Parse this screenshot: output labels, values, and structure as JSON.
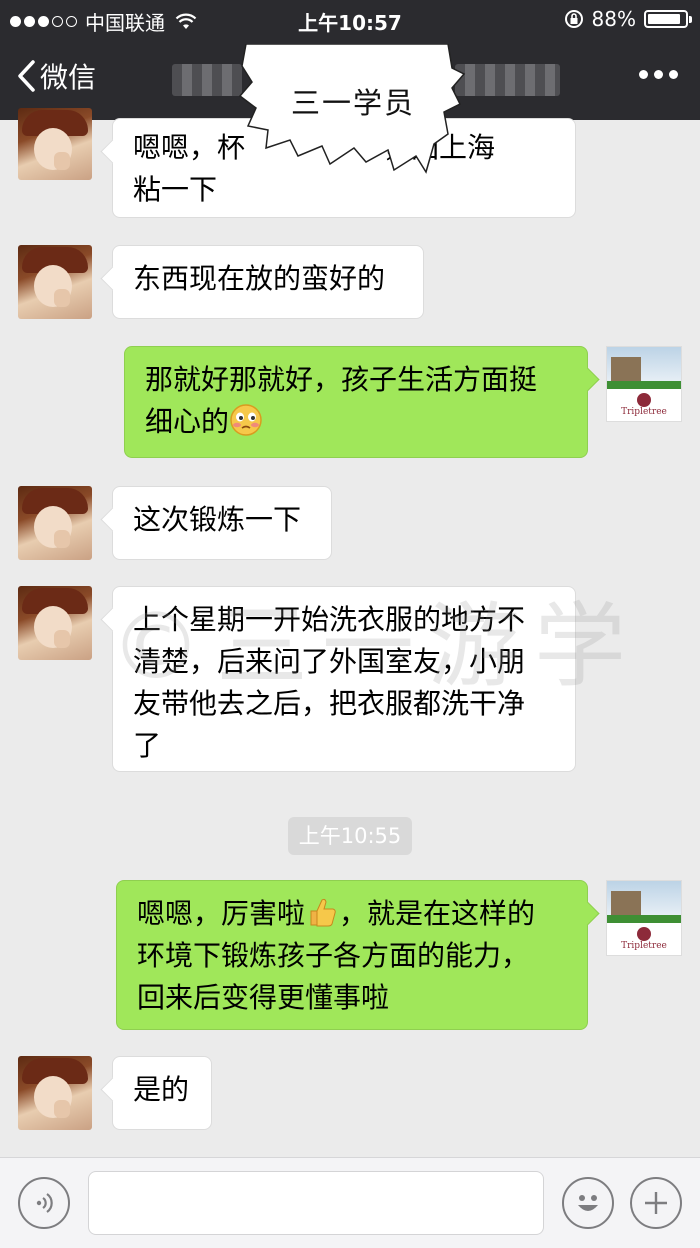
{
  "status_bar": {
    "carrier": "中国联通",
    "time": "上午10:57",
    "battery_percent": "88%",
    "battery_level": 0.88,
    "signal_dots_filled": 3,
    "signal_dots_total": 5
  },
  "nav": {
    "back_label": "微信",
    "overlay_title": "三一学员"
  },
  "messages": [
    {
      "side": "in",
      "text": "嗯嗯，杯",
      "text_tail": "，回上海",
      "line2": "粘一下"
    },
    {
      "side": "in",
      "text": "东西现在放的蛮好的"
    },
    {
      "side": "out",
      "line1": "那就好那就好，孩子生活方面挺",
      "line2": "细心的"
    },
    {
      "side": "in",
      "text": "这次锻炼一下"
    },
    {
      "side": "in",
      "line1": "上个星期一开始洗衣服的地方不",
      "line2": "清楚，后来问了外国室友，小朋",
      "line3": "友带他去之后，把衣服都洗干净",
      "line4": "了"
    },
    {
      "side": "out",
      "line1a": "嗯嗯，厉害啦",
      "line1b": "，就是在这样的",
      "line2": "环境下锻炼孩子各方面的能力，",
      "line3": "回来后变得更懂事啦"
    },
    {
      "side": "in",
      "text": "是的"
    }
  ],
  "timestamp": "上午10:55",
  "watermark": "©三一游学",
  "brand_label": "Tripletree",
  "input": {
    "placeholder": ""
  },
  "icons": {
    "voice": "voice-icon",
    "emoji": "smiley-icon",
    "plus": "plus-icon",
    "more": "more-icon",
    "back": "chevron-left-icon",
    "wifi": "wifi-icon",
    "lock": "rotation-lock-icon"
  },
  "colors": {
    "bar": "#2b2b2f",
    "bubble_out": "#a0e75a",
    "bubble_in": "#ffffff",
    "background": "#ebebeb"
  }
}
